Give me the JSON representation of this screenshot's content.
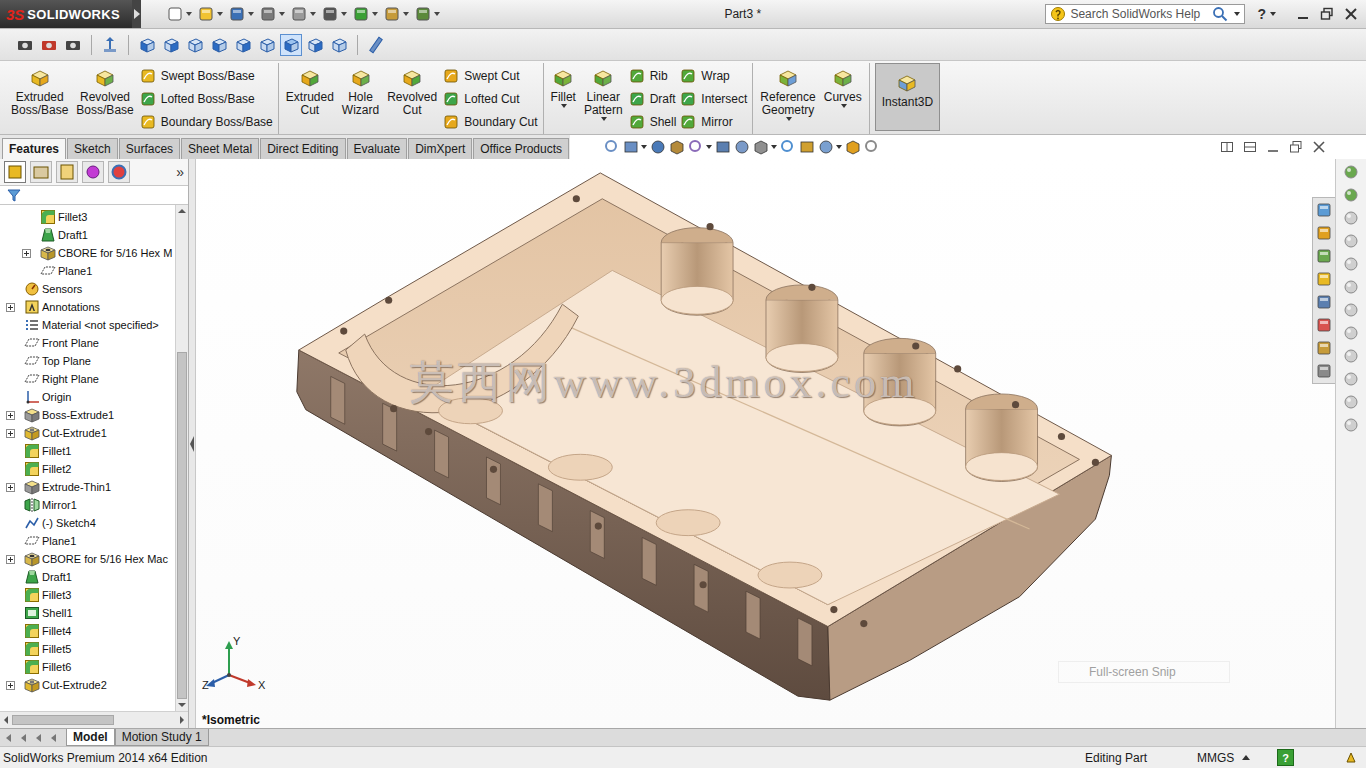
{
  "app": {
    "logo_mark": "3S",
    "logo_text": "SOLIDWORKS",
    "title": "Part3 *"
  },
  "search": {
    "placeholder": "Search SolidWorks Help",
    "help_glyph": "?"
  },
  "standard_views": [
    {
      "selected": false
    },
    {
      "selected": false
    },
    {
      "selected": false
    },
    {
      "selected": false
    },
    {
      "selected": false
    },
    {
      "selected": false
    },
    {
      "selected": true
    },
    {
      "selected": false
    },
    {
      "selected": false
    }
  ],
  "command_groups": [
    {
      "items": [
        {
          "kind": "large",
          "label": "Extruded Boss/Base",
          "dropdown": false,
          "selected": false
        },
        {
          "kind": "large",
          "label": "Revolved Boss/Base",
          "dropdown": false,
          "selected": false
        },
        {
          "kind": "column",
          "entries": [
            "Swept Boss/Base",
            "Lofted Boss/Base",
            "Boundary Boss/Base"
          ]
        }
      ]
    },
    {
      "items": [
        {
          "kind": "large",
          "label": "Extruded Cut",
          "dropdown": false,
          "selected": false
        },
        {
          "kind": "large",
          "label": "Hole Wizard",
          "dropdown": false,
          "selected": false
        },
        {
          "kind": "large",
          "label": "Revolved Cut",
          "dropdown": false,
          "selected": false
        },
        {
          "kind": "column",
          "entries": [
            "Swept Cut",
            "Lofted Cut",
            "Boundary Cut"
          ]
        }
      ]
    },
    {
      "items": [
        {
          "kind": "large",
          "label": "Fillet",
          "dropdown": true,
          "selected": false
        },
        {
          "kind": "large",
          "label": "Linear Pattern",
          "dropdown": true,
          "selected": false
        },
        {
          "kind": "column",
          "entries": [
            "Rib",
            "Draft",
            "Shell"
          ]
        },
        {
          "kind": "column",
          "entries": [
            "Wrap",
            "Intersect",
            "Mirror"
          ]
        }
      ]
    },
    {
      "items": [
        {
          "kind": "large",
          "label": "Reference Geometry",
          "dropdown": true,
          "selected": false
        },
        {
          "kind": "large",
          "label": "Curves",
          "dropdown": true,
          "selected": false
        }
      ]
    },
    {
      "items": [
        {
          "kind": "large",
          "label": "Instant3D",
          "dropdown": false,
          "selected": true
        }
      ]
    }
  ],
  "tabs": [
    {
      "label": "Features",
      "selected": true
    },
    {
      "label": "Sketch",
      "selected": false
    },
    {
      "label": "Surfaces",
      "selected": false
    },
    {
      "label": "Sheet Metal",
      "selected": false
    },
    {
      "label": "Direct Editing",
      "selected": false
    },
    {
      "label": "Evaluate",
      "selected": false
    },
    {
      "label": "DimXpert",
      "selected": false
    },
    {
      "label": "Office Products",
      "selected": false
    }
  ],
  "panel": {
    "tabs": [
      {
        "selected": true
      },
      {
        "selected": false
      },
      {
        "selected": false
      },
      {
        "selected": false
      },
      {
        "selected": false
      }
    ],
    "more": "»"
  },
  "tree": [
    {
      "label": "Fillet3",
      "level": 1,
      "kind": "fillet",
      "expandable": false
    },
    {
      "label": "Draft1",
      "level": 1,
      "kind": "draft",
      "expandable": false
    },
    {
      "label": "CBORE for 5/16 Hex M",
      "level": 1,
      "kind": "hole",
      "expandable": true
    },
    {
      "label": "Plane1",
      "level": 1,
      "kind": "plane",
      "expandable": false
    },
    {
      "label": "Sensors",
      "level": 0,
      "kind": "sensor",
      "expandable": false
    },
    {
      "label": "Annotations",
      "level": 0,
      "kind": "annotation",
      "expandable": true
    },
    {
      "label": "Material <not specified>",
      "level": 0,
      "kind": "material",
      "expandable": false
    },
    {
      "label": "Front Plane",
      "level": 0,
      "kind": "plane",
      "expandable": false
    },
    {
      "label": "Top Plane",
      "level": 0,
      "kind": "plane",
      "expandable": false
    },
    {
      "label": "Right Plane",
      "level": 0,
      "kind": "plane",
      "expandable": false
    },
    {
      "label": "Origin",
      "level": 0,
      "kind": "origin",
      "expandable": false
    },
    {
      "label": "Boss-Extrude1",
      "level": 0,
      "kind": "extrude",
      "expandable": true
    },
    {
      "label": "Cut-Extrude1",
      "level": 0,
      "kind": "cut",
      "expandable": true
    },
    {
      "label": "Fillet1",
      "level": 0,
      "kind": "fillet",
      "expandable": false
    },
    {
      "label": "Fillet2",
      "level": 0,
      "kind": "fillet",
      "expandable": false
    },
    {
      "label": "Extrude-Thin1",
      "level": 0,
      "kind": "extrude",
      "expandable": true
    },
    {
      "label": "Mirror1",
      "level": 0,
      "kind": "mirror",
      "expandable": false
    },
    {
      "label": "(-) Sketch4",
      "level": 0,
      "kind": "sketch",
      "expandable": false
    },
    {
      "label": "Plane1",
      "level": 0,
      "kind": "plane",
      "expandable": false
    },
    {
      "label": "CBORE for 5/16 Hex Mac",
      "level": 0,
      "kind": "hole",
      "expandable": true
    },
    {
      "label": "Draft1",
      "level": 0,
      "kind": "draft",
      "expandable": false
    },
    {
      "label": "Fillet3",
      "level": 0,
      "kind": "fillet",
      "expandable": false
    },
    {
      "label": "Shell1",
      "level": 0,
      "kind": "shell",
      "expandable": false
    },
    {
      "label": "Fillet4",
      "level": 0,
      "kind": "fillet",
      "expandable": false
    },
    {
      "label": "Fillet5",
      "level": 0,
      "kind": "fillet",
      "expandable": false
    },
    {
      "label": "Fillet6",
      "level": 0,
      "kind": "fillet",
      "expandable": false
    },
    {
      "label": "Cut-Extrude2",
      "level": 0,
      "kind": "cut",
      "expandable": true
    }
  ],
  "tree_scroll": {
    "vertical": {
      "level": 0.72,
      "position": 1
    },
    "horizontal": {
      "level": 0.62,
      "position": 0
    }
  },
  "viewport": {
    "view": "*Isometric",
    "watermark": "莫西网www.3dmox.com",
    "snip_hint": "Full-screen Snip",
    "triad": {
      "x": "X",
      "y": "Y",
      "z": "Z"
    }
  },
  "bottom_tabs": [
    {
      "label": "Model",
      "selected": true
    },
    {
      "label": "Motion Study 1",
      "selected": false
    }
  ],
  "status_bar": {
    "edition": "SolidWorks Premium 2014 x64 Edition",
    "mode": "Editing Part",
    "units": "MMGS",
    "help_glyph": "?"
  }
}
